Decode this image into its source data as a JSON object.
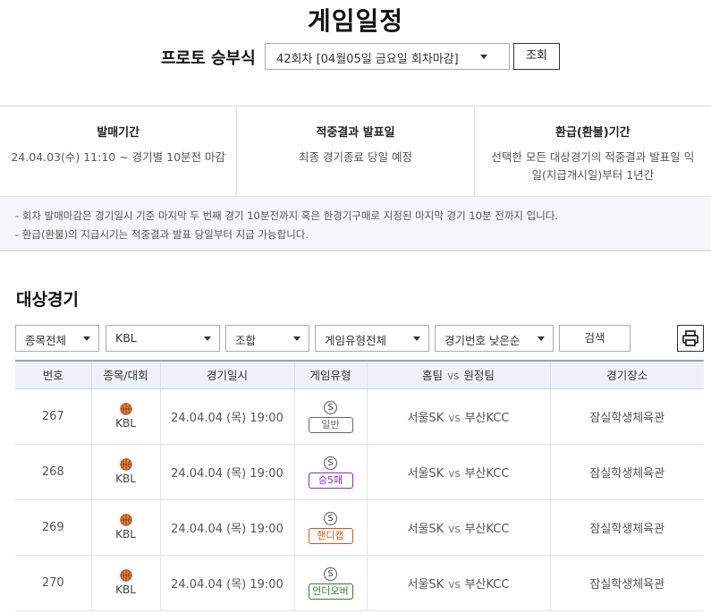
{
  "page_title": "게임일정",
  "round": {
    "label": "프로토 승부식",
    "selected": "42회차 [04월05일 금요일 회차마감]",
    "query_button": "조회"
  },
  "info": [
    {
      "title": "발매기간",
      "body": "24.04.03(수) 11:10 ~ 경기별 10분전 마감"
    },
    {
      "title": "적중결과 발표일",
      "body": "최종 경기종료 당일 예정"
    },
    {
      "title": "환급(환불)기간",
      "body": "선택한 모든 대상경기의 적중결과 발표일 익일(지급개시일)부터 1년간"
    }
  ],
  "notes": [
    "- 회차 발매마감은 경기일시 기준 마지막 두 번째 경기 10분전까지 혹은 한경기구매로 지정된 마지막 경기 10분 전까지 입니다.",
    "- 환급(환불)의 지급시기는 적중결과 발표 당일부터 지급 가능합니다."
  ],
  "section_title": "대상경기",
  "filters": {
    "sport": "종목전체",
    "league": "KBL",
    "combo": "조합",
    "game_type": "게임유형전체",
    "sort": "경기번호 낮은순",
    "search_button": "검색",
    "print_icon": "printer-icon"
  },
  "table": {
    "headers": [
      "번호",
      "종목/대회",
      "경기일시",
      "게임유형",
      "홈팀",
      "vs",
      "원정팀",
      "경기장소"
    ],
    "rows": [
      {
        "no": "267",
        "league": "KBL",
        "datetime": "24.04.04 (목) 19:00",
        "mark": "S",
        "type": "일반",
        "type_color": "#666666",
        "home": "서울SK",
        "vs": "vs",
        "away": "부산KCC",
        "venue": "잠실학생체육관"
      },
      {
        "no": "268",
        "league": "KBL",
        "datetime": "24.04.04 (목) 19:00",
        "mark": "S",
        "type": "승5패",
        "type_color": "#8a2bb5",
        "home": "서울SK",
        "vs": "vs",
        "away": "부산KCC",
        "venue": "잠실학생체육관"
      },
      {
        "no": "269",
        "league": "KBL",
        "datetime": "24.04.04 (목) 19:00",
        "mark": "S",
        "type": "핸디캡",
        "type_color": "#d4541c",
        "home": "서울SK",
        "vs": "vs",
        "away": "부산KCC",
        "venue": "잠실학생체육관"
      },
      {
        "no": "270",
        "league": "KBL",
        "datetime": "24.04.04 (목) 19:00",
        "mark": "S",
        "type": "언더오버",
        "type_color": "#2e7d32",
        "home": "서울SK",
        "vs": "vs",
        "away": "부산KCC",
        "venue": "잠실학생체육관"
      }
    ]
  }
}
